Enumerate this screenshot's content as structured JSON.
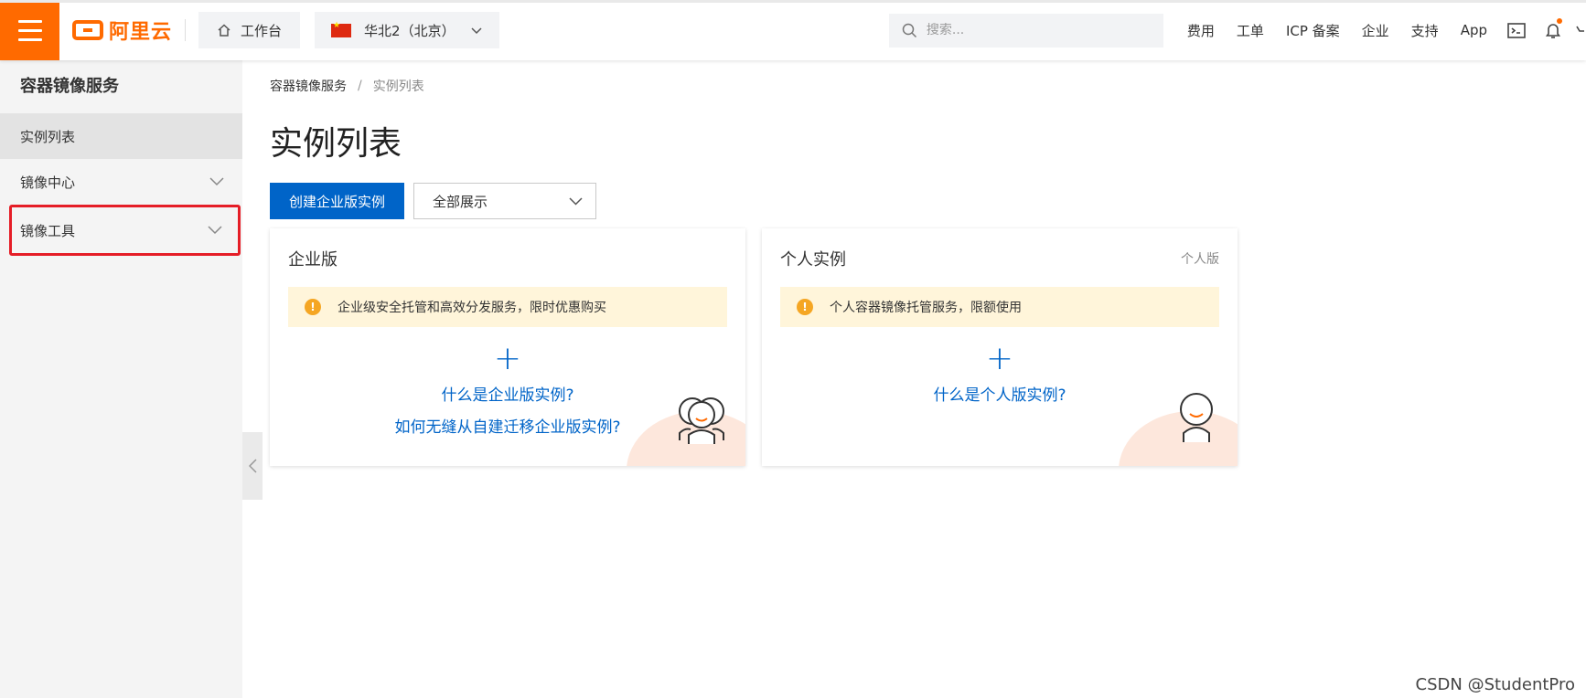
{
  "header": {
    "logo_text": "阿里云",
    "workbench_label": "工作台",
    "region_label": "华北2（北京）",
    "search_placeholder": "搜索...",
    "nav_items": [
      "费用",
      "工单",
      "ICP 备案",
      "企业",
      "支持",
      "App"
    ],
    "accent_color": "#ff6a00"
  },
  "sidebar": {
    "title": "容器镜像服务",
    "items": [
      {
        "label": "实例列表",
        "active": true
      },
      {
        "label": "镜像中心",
        "expandable": true
      },
      {
        "label": "镜像工具",
        "expandable": true,
        "highlighted": true
      }
    ]
  },
  "breadcrumb": {
    "root": "容器镜像服务",
    "separator": "/",
    "current": "实例列表"
  },
  "page": {
    "title": "实例列表",
    "create_button": "创建企业版实例",
    "filter_value": "全部展示",
    "primary_color": "#0064c8"
  },
  "cards": [
    {
      "title": "企业版",
      "tag": "",
      "notice": "企业级安全托管和高效分发服务，限时优惠购买",
      "links": [
        "什么是企业版实例?",
        "如何无缝从自建迁移企业版实例?"
      ]
    },
    {
      "title": "个人实例",
      "tag": "个人版",
      "notice": "个人容器镜像托管服务，限额使用",
      "links": [
        "什么是个人版实例?"
      ]
    }
  ],
  "watermark": "CSDN @StudentPro"
}
